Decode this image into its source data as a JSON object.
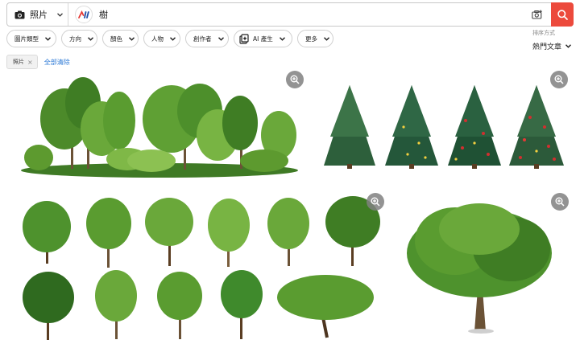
{
  "search": {
    "type_label": "照片",
    "query": "樹"
  },
  "filters": [
    {
      "label": "圖片類型"
    },
    {
      "label": "方向"
    },
    {
      "label": "顏色"
    },
    {
      "label": "人物"
    },
    {
      "label": "創作者"
    },
    {
      "label": "AI 產生"
    },
    {
      "label": "更多"
    }
  ],
  "sort": {
    "label": "排序方式",
    "value": "熱門文章"
  },
  "active_tags": [
    {
      "label": "照片"
    }
  ],
  "clear_all": "全部清除",
  "icons": {
    "type": "camera-icon",
    "camera_search": "camera-plus-icon",
    "search": "magnifier-icon",
    "zoom": "zoom-in-icon",
    "chevron": "chevron-down-icon"
  },
  "colors": {
    "accent": "#ec4a3c",
    "link": "#2b78d6",
    "zoom_bg": "#808080"
  }
}
